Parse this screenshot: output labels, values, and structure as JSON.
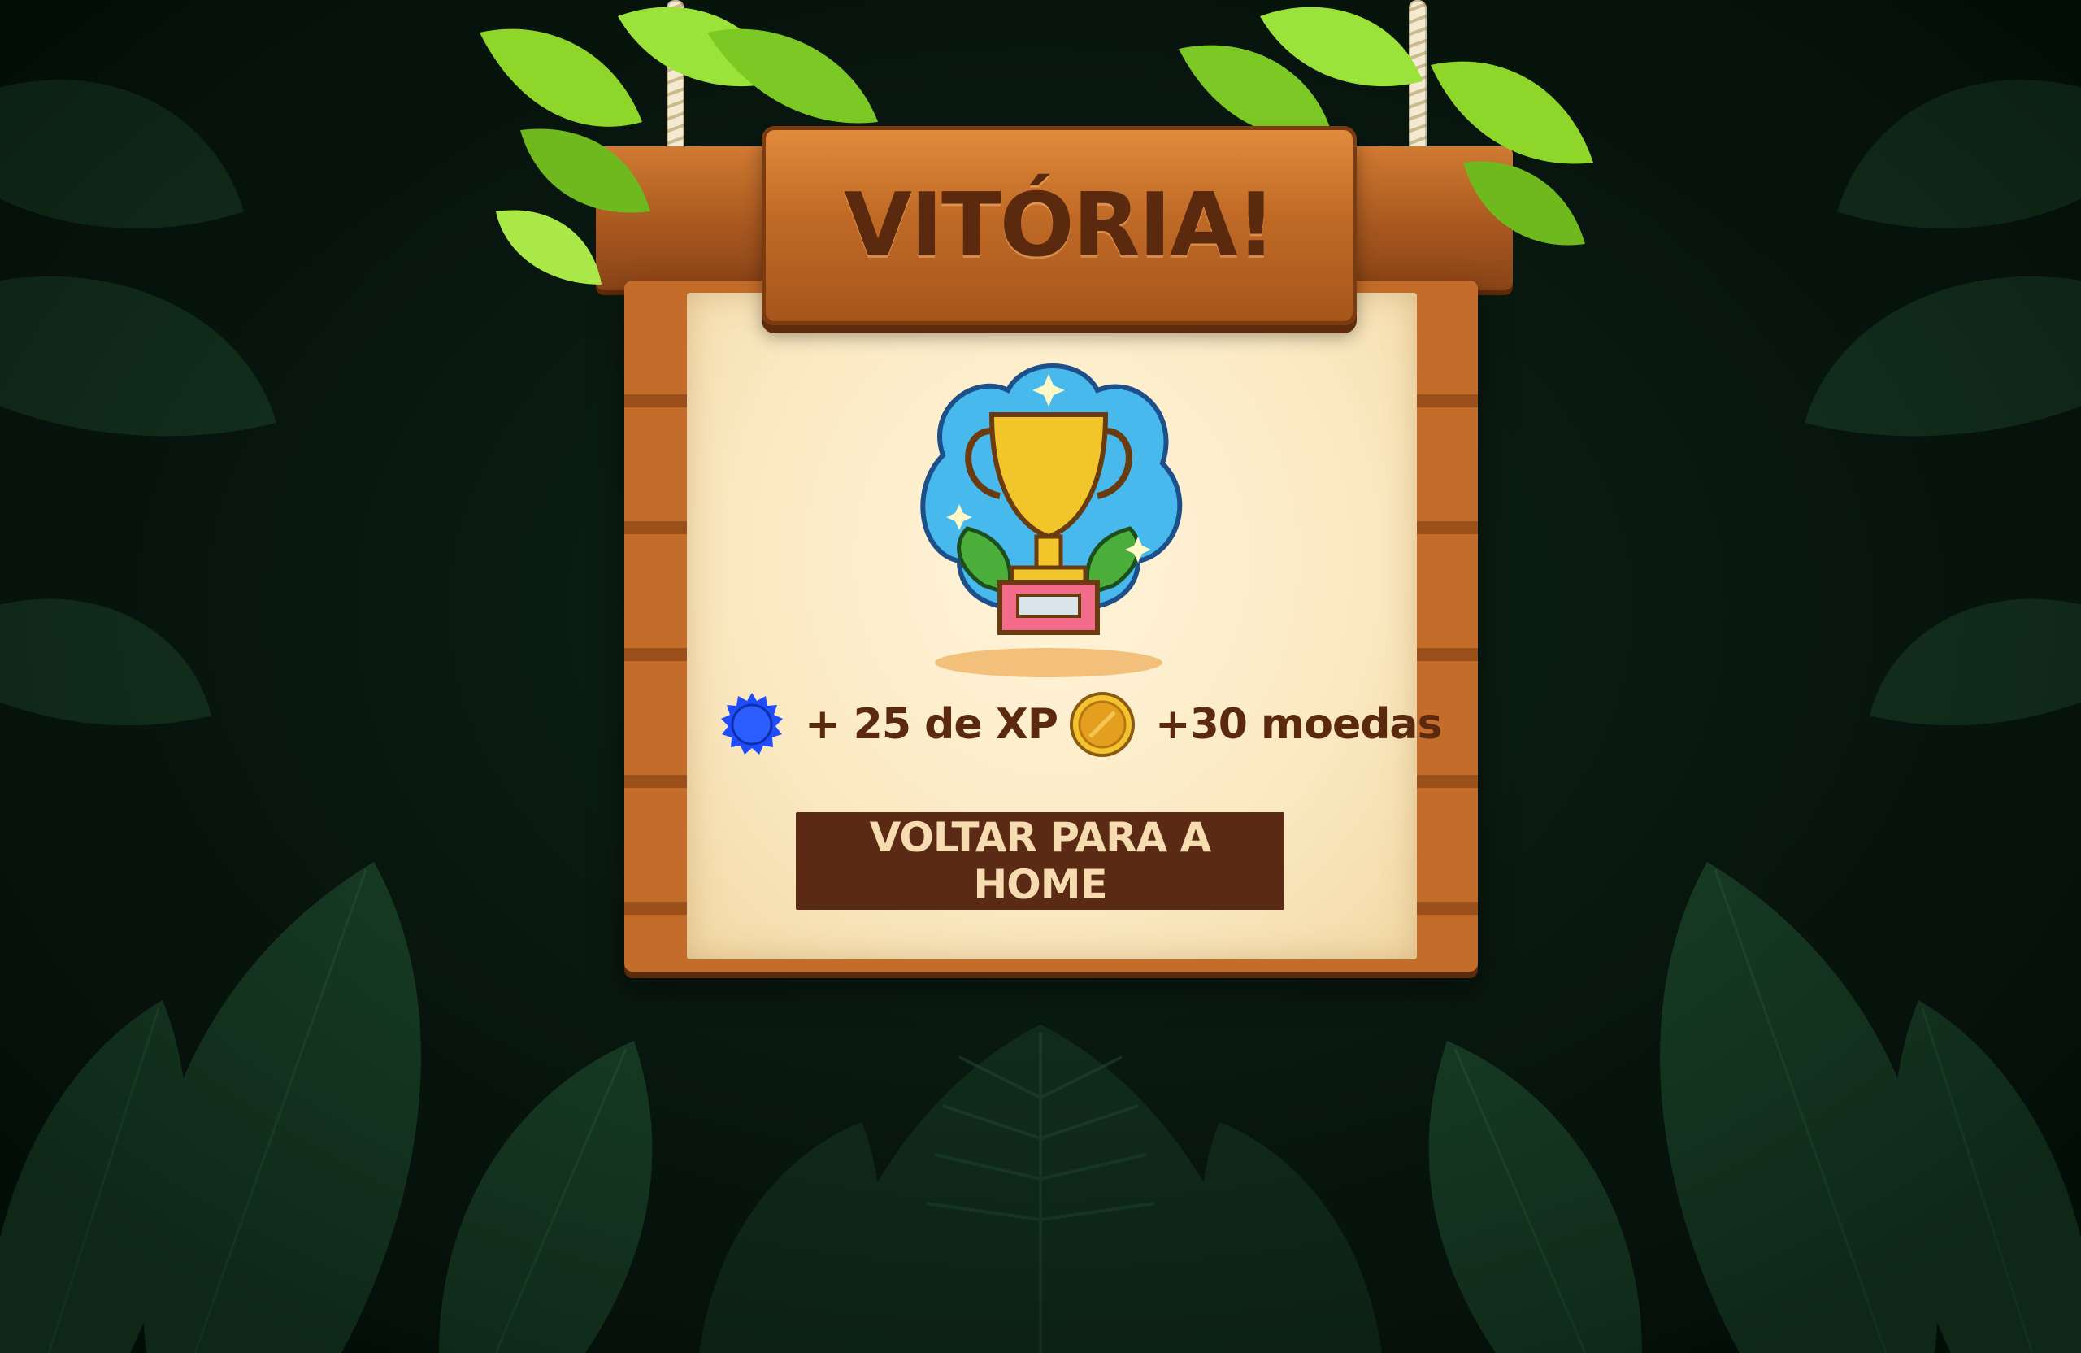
{
  "colors": {
    "background": "#08170f",
    "wood": "#c46d2b",
    "parchment": "#fbe9c2",
    "text_brown": "#5b2a0e",
    "button_bg": "#5b2a14",
    "button_text": "#f6dcb0",
    "xp_badge": "#1f4cff",
    "coin": "#f1b52a"
  },
  "victory": {
    "title": "VITÓRIA!",
    "trophy_icon": "trophy-icon",
    "rewards": {
      "xp": {
        "icon": "xp-badge-icon",
        "text": "+ 25 de XP"
      },
      "coins": {
        "icon": "coin-icon",
        "text": "+30 moedas"
      }
    },
    "home_button": "VOLTAR PARA A HOME"
  }
}
